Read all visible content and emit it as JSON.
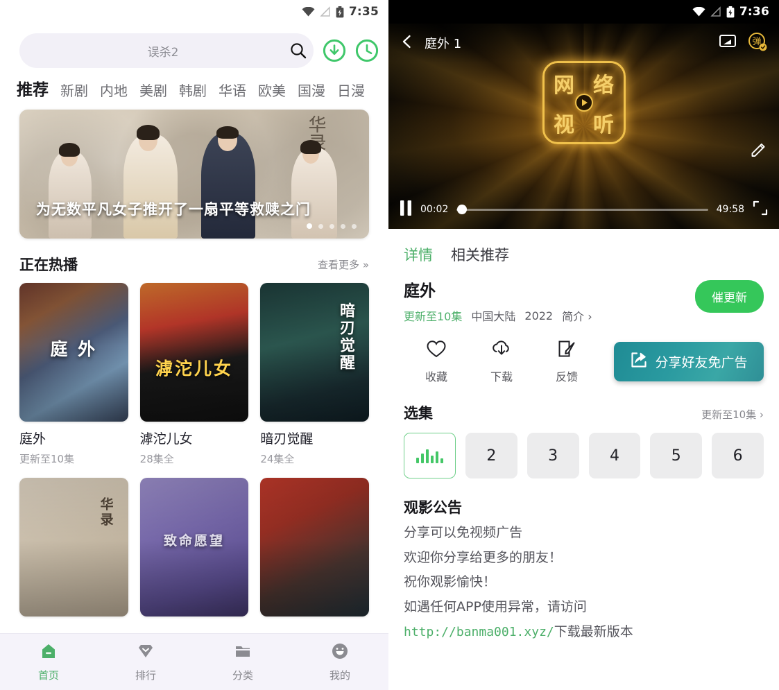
{
  "left": {
    "status_bar": {
      "time": "7:35",
      "icons": [
        "wifi-icon",
        "signal-off-icon",
        "battery-charging-icon"
      ]
    },
    "search": {
      "value": "误杀2",
      "placeholder": "误杀2",
      "search_icon": "search-icon"
    },
    "header_actions": [
      {
        "name": "download-circle-button",
        "icon": "download-arrow-icon"
      },
      {
        "name": "history-circle-button",
        "icon": "clock-icon"
      }
    ],
    "tabs": [
      {
        "label": "推荐",
        "active": true
      },
      {
        "label": "新剧",
        "active": false
      },
      {
        "label": "内地",
        "active": false
      },
      {
        "label": "美剧",
        "active": false
      },
      {
        "label": "韩剧",
        "active": false
      },
      {
        "label": "华语",
        "active": false
      },
      {
        "label": "欧美",
        "active": false
      },
      {
        "label": "国漫",
        "active": false
      },
      {
        "label": "日漫",
        "active": false
      }
    ],
    "banner": {
      "caption": "为无数平凡女子推开了一扇平等救赎之门",
      "artwork_text": "华录",
      "dots_total": 5,
      "dots_active_index": 0
    },
    "section": {
      "title": "正在热播",
      "more": "查看更多",
      "more_icon": "chevron-double-right-icon"
    },
    "cards": [
      {
        "title": "庭外",
        "sub": "更新至10集",
        "poster_text": "庭 外",
        "style": "po1"
      },
      {
        "title": "滹沱儿女",
        "sub": "28集全",
        "poster_text": "滹沱儿女",
        "style": "po2"
      },
      {
        "title": "暗刃觉醒",
        "sub": "24集全",
        "poster_text": "暗刃觉醒",
        "style": "po3"
      }
    ],
    "cards_row2": [
      {
        "poster_text": "华录",
        "style": "po4"
      },
      {
        "poster_text": "致命愿望",
        "style": "po5"
      },
      {
        "poster_text": "",
        "style": "po6"
      }
    ],
    "bottom_nav": [
      {
        "label": "首页",
        "icon": "home-icon",
        "active": true
      },
      {
        "label": "排行",
        "icon": "diamond-icon",
        "active": false
      },
      {
        "label": "分类",
        "icon": "folder-icon",
        "active": false
      },
      {
        "label": "我的",
        "icon": "profile-icon",
        "active": false
      }
    ]
  },
  "right": {
    "status_bar": {
      "time": "7:36",
      "icons": [
        "wifi-icon",
        "signal-off-icon",
        "battery-charging-icon"
      ]
    },
    "player": {
      "back_icon": "chevron-left-icon",
      "title": "庭外 1",
      "cast_icon": "cast-screen-icon",
      "danmaku_icon": "danmaku-badge-icon",
      "danmaku_glyph": "弹",
      "edit_icon": "pencil-icon",
      "play_state_icon": "pause-icon",
      "current_time": "00:02",
      "duration": "49:58",
      "fullscreen_icon": "fullscreen-icon",
      "progress_percent": 2,
      "logo_chars": [
        "网",
        "络",
        "视",
        "听"
      ],
      "logo_play_icon": "play-triangle-icon"
    },
    "detail_tabs": [
      {
        "label": "详情",
        "active": true
      },
      {
        "label": "相关推荐",
        "active": false
      }
    ],
    "show": {
      "title": "庭外",
      "update_status": "更新至10集",
      "region": "中国大陆",
      "year": "2022",
      "synopsis_label": "简介",
      "synopsis_icon": "chevron-right-icon",
      "urge_button": "催更新"
    },
    "actions": [
      {
        "label": "收藏",
        "icon": "heart-icon"
      },
      {
        "label": "下载",
        "icon": "cloud-download-icon"
      },
      {
        "label": "反馈",
        "icon": "feedback-edit-icon"
      }
    ],
    "share_button": {
      "label": "分享好友免广告",
      "icon": "share-box-icon",
      "color": "#2a9aa0"
    },
    "episodes": {
      "title": "选集",
      "more": "更新至10集",
      "more_icon": "chevron-right-icon",
      "items": [
        {
          "label": "1",
          "current": true,
          "icon": "playing-bars-icon"
        },
        {
          "label": "2",
          "current": false
        },
        {
          "label": "3",
          "current": false
        },
        {
          "label": "4",
          "current": false
        },
        {
          "label": "5",
          "current": false
        },
        {
          "label": "6",
          "current": false
        }
      ]
    },
    "announcement": {
      "title": "观影公告",
      "lines": [
        "分享可以免视频广告",
        "欢迎你分享给更多的朋友！",
        "祝你观影愉快！",
        "如遇任何APP使用异常，请访问"
      ],
      "link": "http://banma001.xyz/",
      "link_suffix": "下载最新版本"
    }
  },
  "colors": {
    "accent_green": "#4caf69",
    "urge_green": "#35c75a",
    "teal": "#2a9aa0",
    "gold": "#f0c14b"
  }
}
